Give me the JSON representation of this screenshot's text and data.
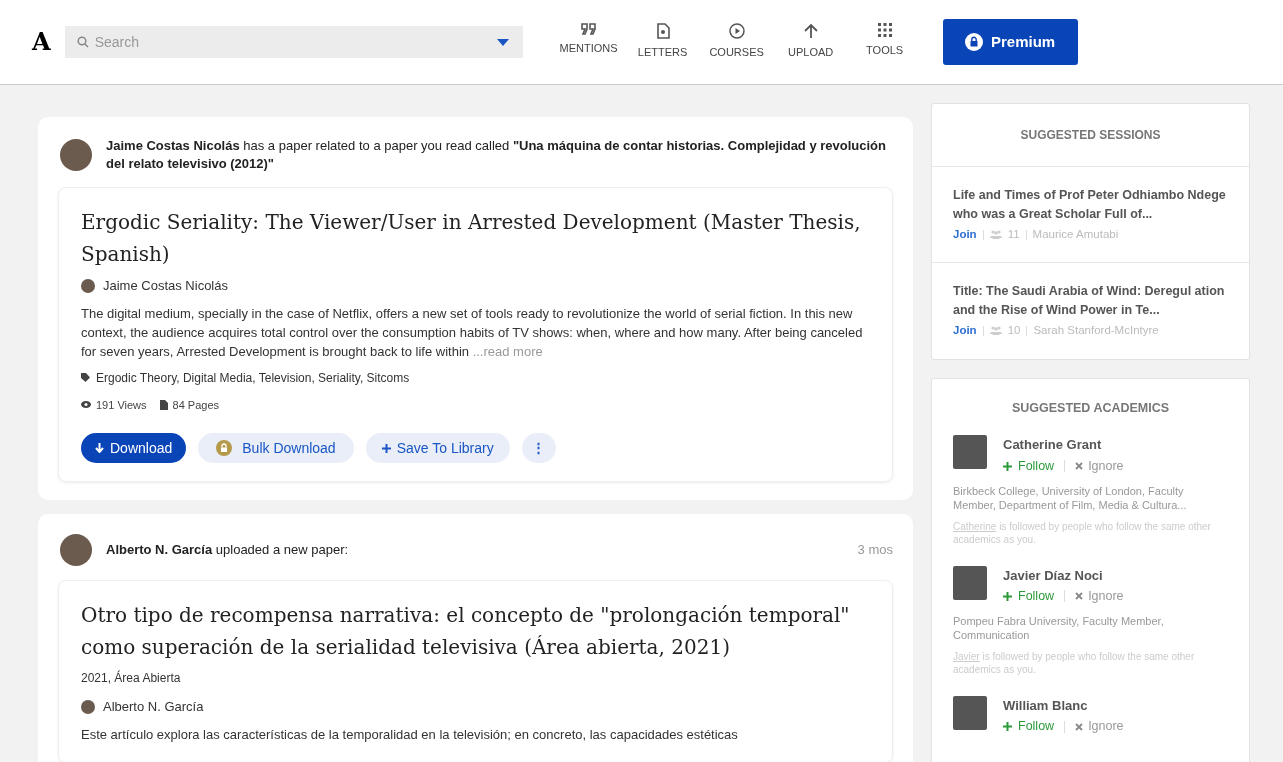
{
  "header": {
    "logo": "A",
    "search": {
      "placeholder": "Search"
    },
    "nav": [
      {
        "kind": "mentions",
        "label": "MENTIONS"
      },
      {
        "kind": "letters",
        "label": "LETTERS"
      },
      {
        "kind": "courses",
        "label": "COURSES"
      },
      {
        "kind": "upload",
        "label": "UPLOAD"
      },
      {
        "kind": "tools",
        "label": "TOOLS"
      }
    ],
    "premium": "Premium"
  },
  "feed": [
    {
      "headline": "**Jaime Costas Nicolás** has a paper related to a paper you read called **\"Una máquina de contar historias. Complejidad y revolución del relato televisivo (2012)\"**",
      "paper": {
        "title": "Ergodic Seriality: The Viewer/User in Arrested Development (Master Thesis, Spanish)",
        "author": "Jaime Costas Nicolás",
        "abstract": "The digital medium, specially in the case of Netflix, offers a new set of tools ready to revolutionize the world of serial fiction. In this new context, the audience acquires total control over the consumption habits of TV shows: when, where and how many. After being canceled for seven years, Arrested Development is brought back to life within",
        "read_more": "...read more",
        "tags": "Ergodic Theory, Digital Media, Television, Seriality, Sitcoms",
        "views": "191 Views",
        "pages": "84 Pages",
        "actions": {
          "download": "Download",
          "bulk": "Bulk Download",
          "save": "Save To Library",
          "more": "⋮"
        }
      }
    },
    {
      "headline": "**Alberto N. García** uploaded a new paper:",
      "time": "3 mos",
      "paper": {
        "title": "Otro tipo de recompensa narrativa: el concepto de \"prolongación temporal\" como superación de la serialidad televisiva (Área abierta, 2021)",
        "meta": "2021, Área Abierta",
        "author": "Alberto N. García",
        "abstract": "Este artículo explora las características de la temporalidad en la televisión; en concreto, las capacidades estéticas"
      }
    }
  ],
  "sessions": {
    "title": "SUGGESTED SESSIONS",
    "items": [
      {
        "title": "Life and Times of Prof Peter Odhiambo Ndege who was a Great Scholar Full of...",
        "join": "Join",
        "count": "11",
        "host": "Maurice Amutabi"
      },
      {
        "title": "Title: The Saudi Arabia of Wind: Deregul ation and the Rise of Wind Power in Te...",
        "join": "Join",
        "count": "10",
        "host": "Sarah Stanford-McIntyre"
      }
    ]
  },
  "academics": {
    "title": "SUGGESTED ACADEMICS",
    "items": [
      {
        "name": "Catherine Grant",
        "follow": "Follow",
        "ignore": "Ignore",
        "affiliation": "Birkbeck College, University of London, Faculty Member, Department of Film, Media & Cultura...",
        "note_name": "Catherine",
        "note": "is followed by people who follow the same other academics as you."
      },
      {
        "name": "Javier Díaz Noci",
        "follow": "Follow",
        "ignore": "Ignore",
        "affiliation": "Pompeu Fabra University, Faculty Member, Communication",
        "note_name": "Javier",
        "note": "is followed by people who follow the same other academics as you."
      },
      {
        "name": "William Blanc",
        "follow": "Follow",
        "ignore": "Ignore"
      }
    ]
  }
}
